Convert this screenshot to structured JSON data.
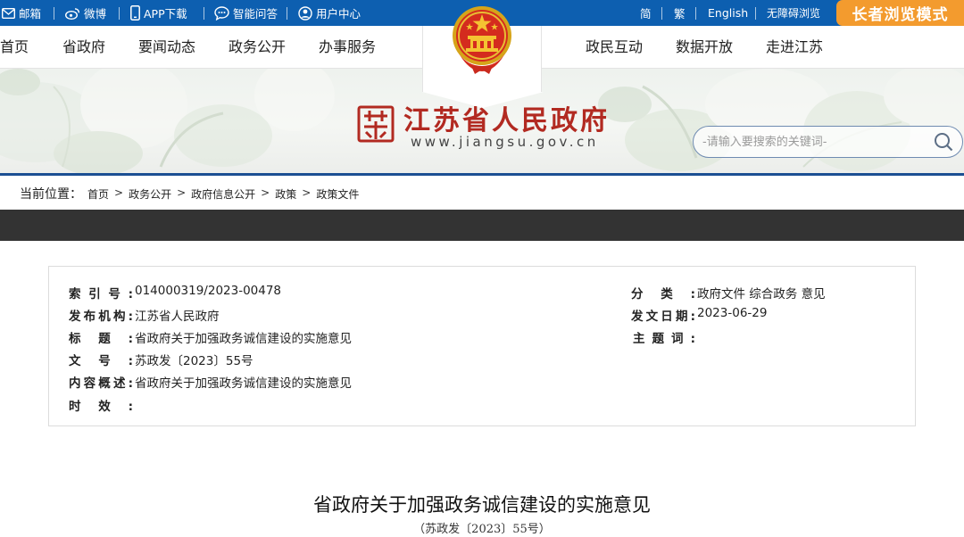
{
  "topbar": {
    "mail": "邮箱",
    "weibo": "微博",
    "app": "APP下载",
    "qa": "智能问答",
    "user_center": "用户中心",
    "simplified": "简",
    "traditional": "繁",
    "english": "English",
    "accessibility": "无障碍浏览",
    "elder_mode": "长者浏览模式"
  },
  "nav": {
    "left": [
      "首页",
      "省政府",
      "要闻动态",
      "政务公开",
      "办事服务"
    ],
    "right": [
      "政民互动",
      "数据开放",
      "走进江苏"
    ]
  },
  "header": {
    "site_name": "江苏省人民政府",
    "site_url": "www.jiangsu.gov.cn"
  },
  "search": {
    "placeholder": "-请输入要搜索的关键词-"
  },
  "breadcrumb": {
    "label": "当前位置：",
    "items": [
      "首页",
      "政务公开",
      "政府信息公开",
      "政策",
      "政策文件"
    ]
  },
  "meta": {
    "index_no_key": "索引号:",
    "index_no": "014000319/2023-00478",
    "category_key": "分类:",
    "category": "政府文件 综合政务 意见",
    "issuer_key": "发布机构:",
    "issuer": "江苏省人民政府",
    "date_key": "发文日期:",
    "date": "2023-06-29",
    "title_key": "标题:",
    "title": "省政府关于加强政务诚信建设的实施意见",
    "keywords_key": "主题词:",
    "keywords": "",
    "doc_no_key": "文号:",
    "doc_no": "苏政发〔2023〕55号",
    "summary_key": "内容概述:",
    "summary": "省政府关于加强政务诚信建设的实施意见",
    "validity_key": "时效:",
    "validity": ""
  },
  "document": {
    "title": "省政府关于加强政务诚信建设的实施意见",
    "subtitle": "（苏政发〔2023〕55号）"
  },
  "colors": {
    "topbar": "#0d5fb0",
    "elder_button": "#f39b2e",
    "site_name": "#b22a21",
    "banner_rule": "#1b4f93",
    "dark_strip": "#333333"
  }
}
